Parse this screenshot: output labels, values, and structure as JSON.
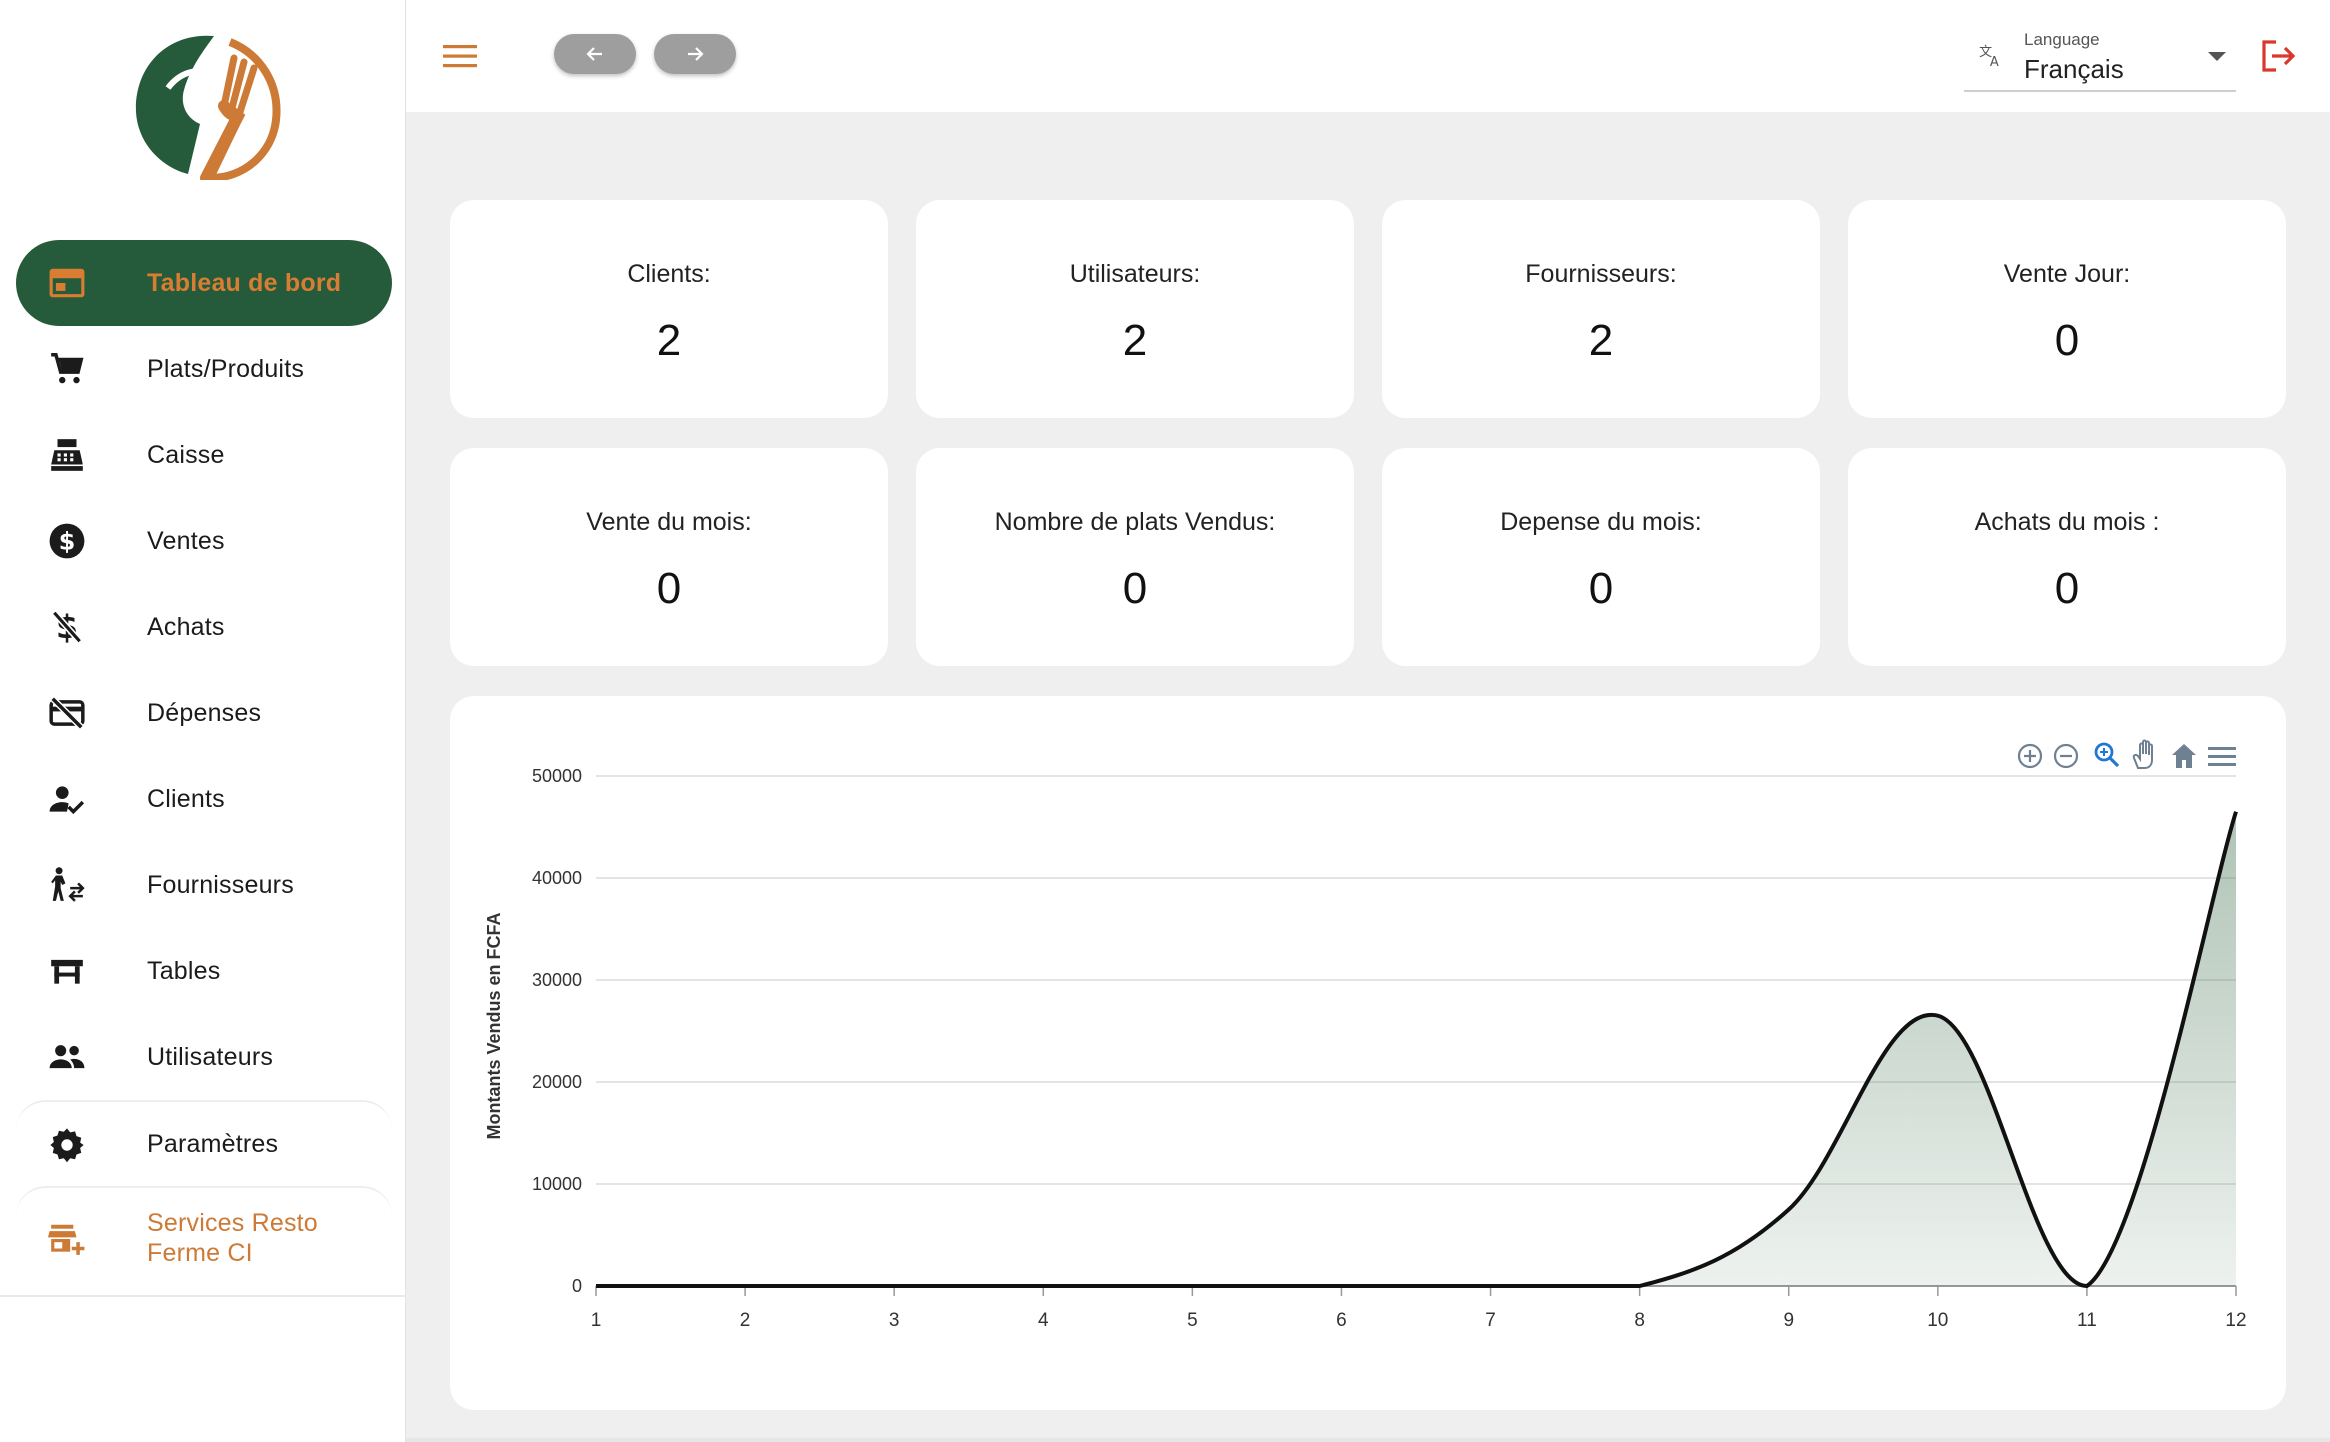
{
  "sidebar": {
    "logo_icon": "fork-leaf-logo-icon",
    "items": [
      {
        "label": "Tableau de bord",
        "icon": "dashboard-icon",
        "active": true
      },
      {
        "label": "Plats/Produits",
        "icon": "cart-icon"
      },
      {
        "label": "Caisse",
        "icon": "cash-register-icon"
      },
      {
        "label": "Ventes",
        "icon": "dollar-circle-icon"
      },
      {
        "label": "Achats",
        "icon": "money-off-icon"
      },
      {
        "label": "Dépenses",
        "icon": "card-off-icon"
      },
      {
        "label": "Clients",
        "icon": "person-check-icon"
      },
      {
        "label": "Fournisseurs",
        "icon": "person-transfer-icon"
      },
      {
        "label": "Tables",
        "icon": "table-icon"
      },
      {
        "label": "Utilisateurs",
        "icon": "group-icon"
      },
      {
        "label": "Paramètres",
        "icon": "gear-icon"
      },
      {
        "label": "Services Resto Ferme CI",
        "icon": "store-add-icon"
      }
    ],
    "colors": {
      "active_bg": "#255b3b",
      "accent": "#d87d32"
    }
  },
  "header": {
    "menu_icon": "hamburger-menu-icon",
    "back_icon": "arrow-left-icon",
    "forward_icon": "arrow-right-icon",
    "language": {
      "caption": "Language",
      "value": "Français",
      "icon": "translate-icon"
    },
    "logout_icon": "logout-icon"
  },
  "stats": [
    {
      "title": "Clients:",
      "value": "2"
    },
    {
      "title": "Utilisateurs:",
      "value": "2"
    },
    {
      "title": "Fournisseurs:",
      "value": "2"
    },
    {
      "title": "Vente Jour:",
      "value": "0"
    },
    {
      "title": "Vente du mois:",
      "value": "0"
    },
    {
      "title": "Nombre de plats Vendus:",
      "value": "0"
    },
    {
      "title": "Depense du mois:",
      "value": "0"
    },
    {
      "title": "Achats du mois :",
      "value": "0"
    }
  ],
  "chart_toolbar": [
    "zoom-in-icon",
    "zoom-out-icon",
    "zoom-selection-icon",
    "pan-hand-icon",
    "home-reset-icon",
    "menu-lines-icon"
  ],
  "chart_data": {
    "type": "area",
    "x": [
      1,
      2,
      3,
      4,
      5,
      6,
      7,
      8,
      9,
      10,
      11,
      12
    ],
    "series": [
      {
        "values": [
          0,
          0,
          0,
          0,
          0,
          0,
          0,
          0,
          7500,
          26500,
          0,
          46500
        ]
      }
    ],
    "title": "",
    "xlabel": "",
    "ylabel": "Montants Vendus en FCFA",
    "ylim": [
      0,
      50000
    ],
    "yticks": [
      0,
      10000,
      20000,
      30000,
      40000,
      50000
    ],
    "grid": true,
    "legend": "none",
    "colors": {
      "line": "#111111",
      "fill": "#4e7a5c"
    }
  }
}
